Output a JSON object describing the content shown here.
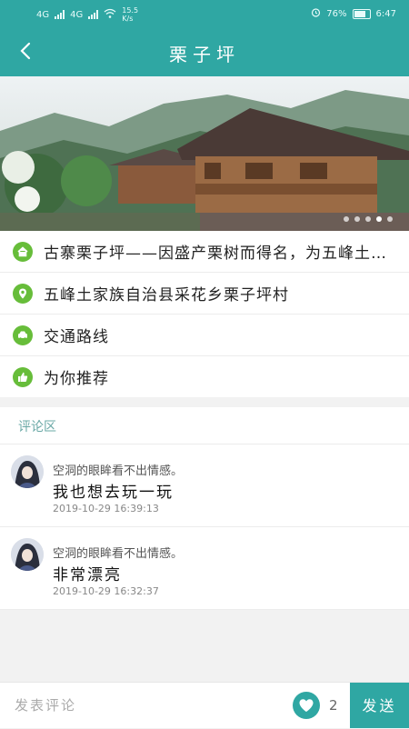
{
  "status_bar": {
    "network_1": "4G",
    "network_2": "4G",
    "speed": "15.5",
    "speed_unit": "K/s",
    "battery": "76%",
    "time": "6:47"
  },
  "header": {
    "title": "栗子坪"
  },
  "banner": {
    "dot_count": 5,
    "active_dot": 4
  },
  "info": [
    {
      "icon": "home-icon",
      "text": "古寨栗子坪——因盛产栗树而得名，为五峰土家族自治县…"
    },
    {
      "icon": "location-pin-icon",
      "text": "五峰土家族自治县采花乡栗子坪村"
    },
    {
      "icon": "car-icon",
      "text": "交通路线"
    },
    {
      "icon": "thumbs-up-icon",
      "text": "为你推荐"
    }
  ],
  "comments": {
    "title": "评论区",
    "items": [
      {
        "user": "空洞的眼眸看不出情感。",
        "text": "我也想去玩一玩",
        "time": "2019-10-29 16:39:13"
      },
      {
        "user": "空洞的眼眸看不出情感。",
        "text": "非常漂亮",
        "time": "2019-10-29 16:32:37"
      }
    ]
  },
  "bottom_bar": {
    "placeholder": "发表评论",
    "like_count": "2",
    "send_label": "发送"
  },
  "colors": {
    "accent": "#2fa7a3",
    "icon_green": "#67bd3a"
  }
}
